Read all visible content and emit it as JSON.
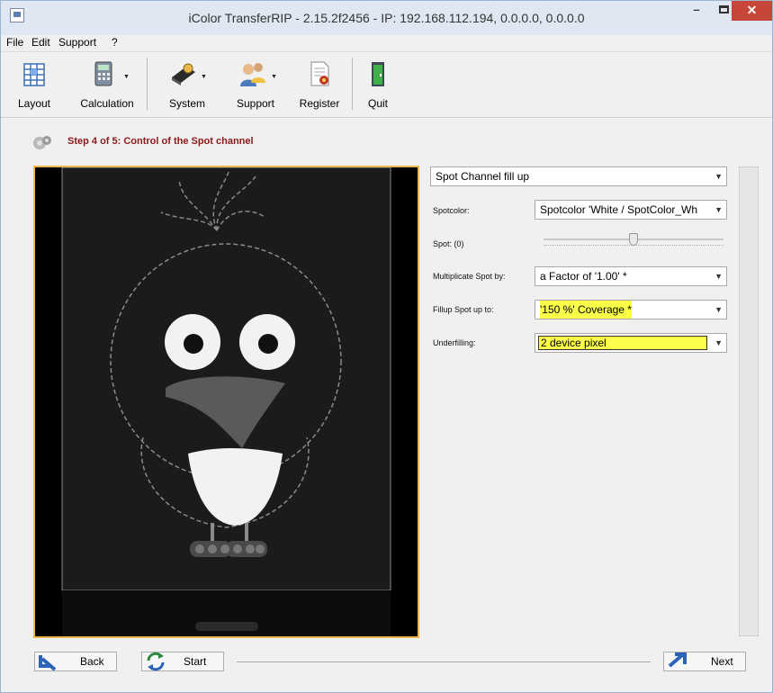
{
  "window": {
    "title": "iColor TransferRIP - 2.15.2f2456 - IP: 192.168.112.194, 0.0.0.0, 0.0.0.0",
    "minimize": "–",
    "close": "✕"
  },
  "menu": [
    "File",
    "Edit",
    "Support",
    "?"
  ],
  "toolbar": {
    "layout": "Layout",
    "calculation": "Calculation",
    "system": "System",
    "support": "Support",
    "register": "Register",
    "quit": "Quit"
  },
  "step": {
    "title": "Step 4 of 5: Control of the Spot channel"
  },
  "panel": {
    "mode_select": "Spot Channel fill up",
    "spotcolor_label": "Spotcolor:",
    "spotcolor_value": "Spotcolor 'White / SpotColor_Wh",
    "spot_label": "Spot: (0)",
    "spot_slider_level": 0.5,
    "multiplicate_label": "Multiplicate Spot by:",
    "multiplicate_value": "a Factor of '1.00' *",
    "fillup_label": "Fillup Spot up to:",
    "fillup_value": "'150 %' Coverage *",
    "underfilling_label": "Underfilling:",
    "underfilling_value": "2 device pixel"
  },
  "buttons": {
    "back": "Back",
    "start": "Start",
    "next": "Next"
  },
  "colors": {
    "accent_title": "#8b1a1a",
    "highlight": "#fbff4a",
    "preview_border": "#f0b54a",
    "close_button": "#c7463a"
  }
}
